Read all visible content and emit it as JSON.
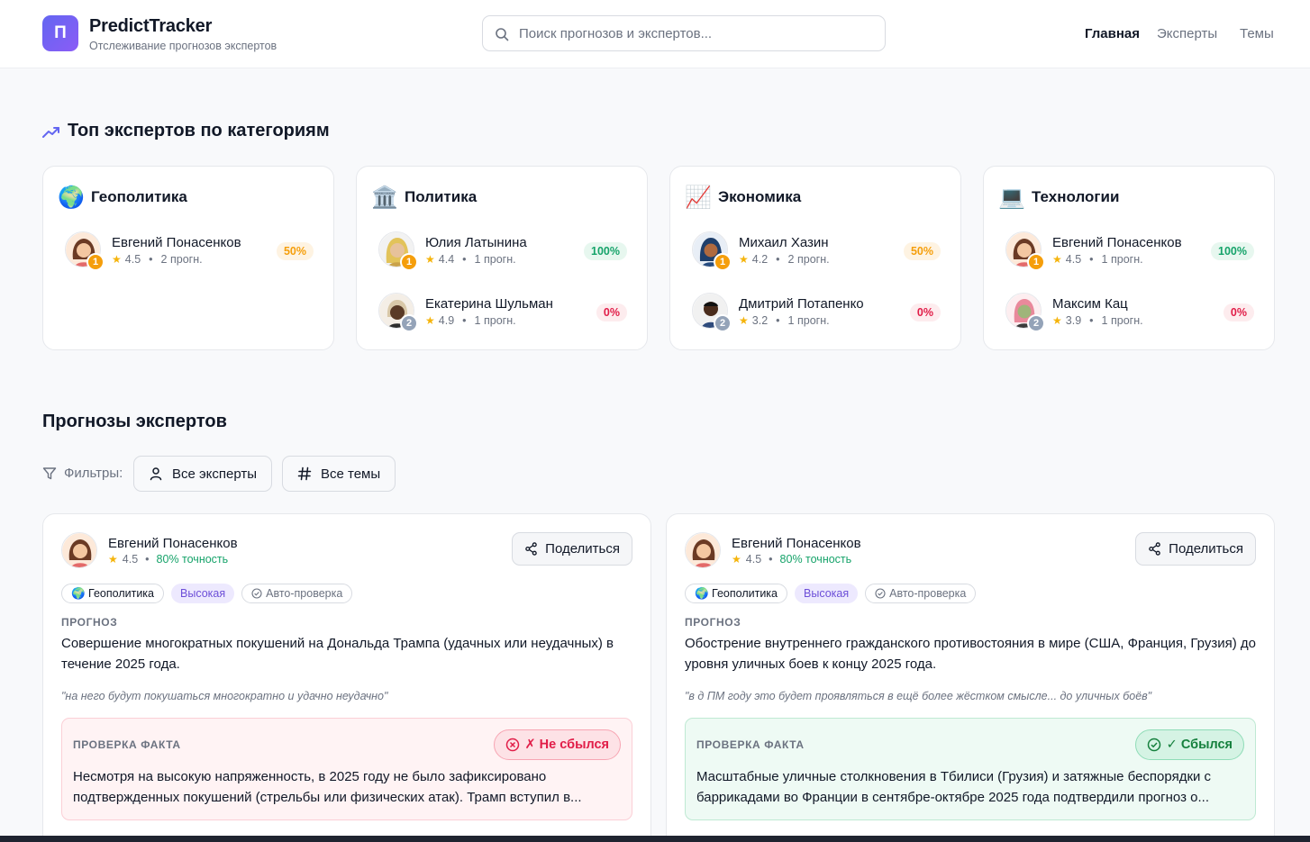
{
  "header": {
    "logo_letter": "П",
    "brand": "PredictTracker",
    "tagline": "Отслеживание прогнозов экспертов",
    "search_placeholder": "Поиск прогнозов и экспертов...",
    "nav": [
      "Главная",
      "Эксперты",
      "Темы"
    ]
  },
  "top_experts": {
    "title": "Топ экспертов по категориям",
    "categories": [
      {
        "emoji": "🌍",
        "name": "Геополитика",
        "experts": [
          {
            "name": "Евгений Понасенков",
            "rank": "1",
            "rating": "4.5",
            "count": "2 прогн.",
            "pct": "50%",
            "pct_tone": "amber"
          }
        ]
      },
      {
        "emoji": "🏛️",
        "name": "Политика",
        "experts": [
          {
            "name": "Юлия Латынина",
            "rank": "1",
            "rating": "4.4",
            "count": "1 прогн.",
            "pct": "100%",
            "pct_tone": "green"
          },
          {
            "name": "Екатерина Шульман",
            "rank": "2",
            "rating": "4.9",
            "count": "1 прогн.",
            "pct": "0%",
            "pct_tone": "red"
          }
        ]
      },
      {
        "emoji": "📈",
        "name": "Экономика",
        "experts": [
          {
            "name": "Михаил Хазин",
            "rank": "1",
            "rating": "4.2",
            "count": "2 прогн.",
            "pct": "50%",
            "pct_tone": "amber"
          },
          {
            "name": "Дмитрий Потапенко",
            "rank": "2",
            "rating": "3.2",
            "count": "1 прогн.",
            "pct": "0%",
            "pct_tone": "red"
          }
        ]
      },
      {
        "emoji": "💻",
        "name": "Технологии",
        "experts": [
          {
            "name": "Евгений Понасенков",
            "rank": "1",
            "rating": "4.5",
            "count": "1 прогн.",
            "pct": "100%",
            "pct_tone": "green"
          },
          {
            "name": "Максим Кац",
            "rank": "2",
            "rating": "3.9",
            "count": "1 прогн.",
            "pct": "0%",
            "pct_tone": "red"
          }
        ]
      }
    ]
  },
  "predictions": {
    "title": "Прогнозы экспертов",
    "filters_label": "Фильтры:",
    "filter_experts": "Все эксперты",
    "filter_topics": "Все темы",
    "share_label": "Поделиться",
    "prediction_label": "ПРОГНОЗ",
    "fact_label": "ПРОВЕРКА ФАКТА",
    "items": [
      {
        "expert": "Евгений Понасенков",
        "rating": "4.5",
        "accuracy": "80% точность",
        "topic": "🌍 Геополитика",
        "level": "Высокая",
        "check": "Авто-проверка",
        "text": "Совершение многократных покушений на Дональда Трампа (удачных или неудачных) в течение 2025 года.",
        "quote": "\"на него будут покушаться многократно и удачно неудачно\"",
        "verdict": "✗ Не сбылся",
        "verdict_tone": "bad",
        "fact_text": "Несмотря на высокую напряженность, в 2025 году не было зафиксировано подтвержденных покушений (стрельбы или физических атак). Трамп вступил в..."
      },
      {
        "expert": "Евгений Понасенков",
        "rating": "4.5",
        "accuracy": "80% точность",
        "topic": "🌍 Геополитика",
        "level": "Высокая",
        "check": "Авто-проверка",
        "text": "Обострение внутреннего гражданского противостояния в мире (США, Франция, Грузия) до уровня уличных боев к концу 2025 года.",
        "quote": "\"в д ПМ году это будет проявляться в ещё более жёстком смысле... до уличных боёв\"",
        "verdict": "✓ Сбылся",
        "verdict_tone": "good",
        "fact_text": "Масштабные уличные столкновения в Тбилиси (Грузия) и затяжные беспорядки с баррикадами во Франции в сентябре-октябре 2025 года подтвердили прогноз о..."
      }
    ]
  },
  "colors": {
    "accent": "#6366f1",
    "success": "#16a36a",
    "danger": "#e11d48",
    "warning": "#f59e0b"
  }
}
